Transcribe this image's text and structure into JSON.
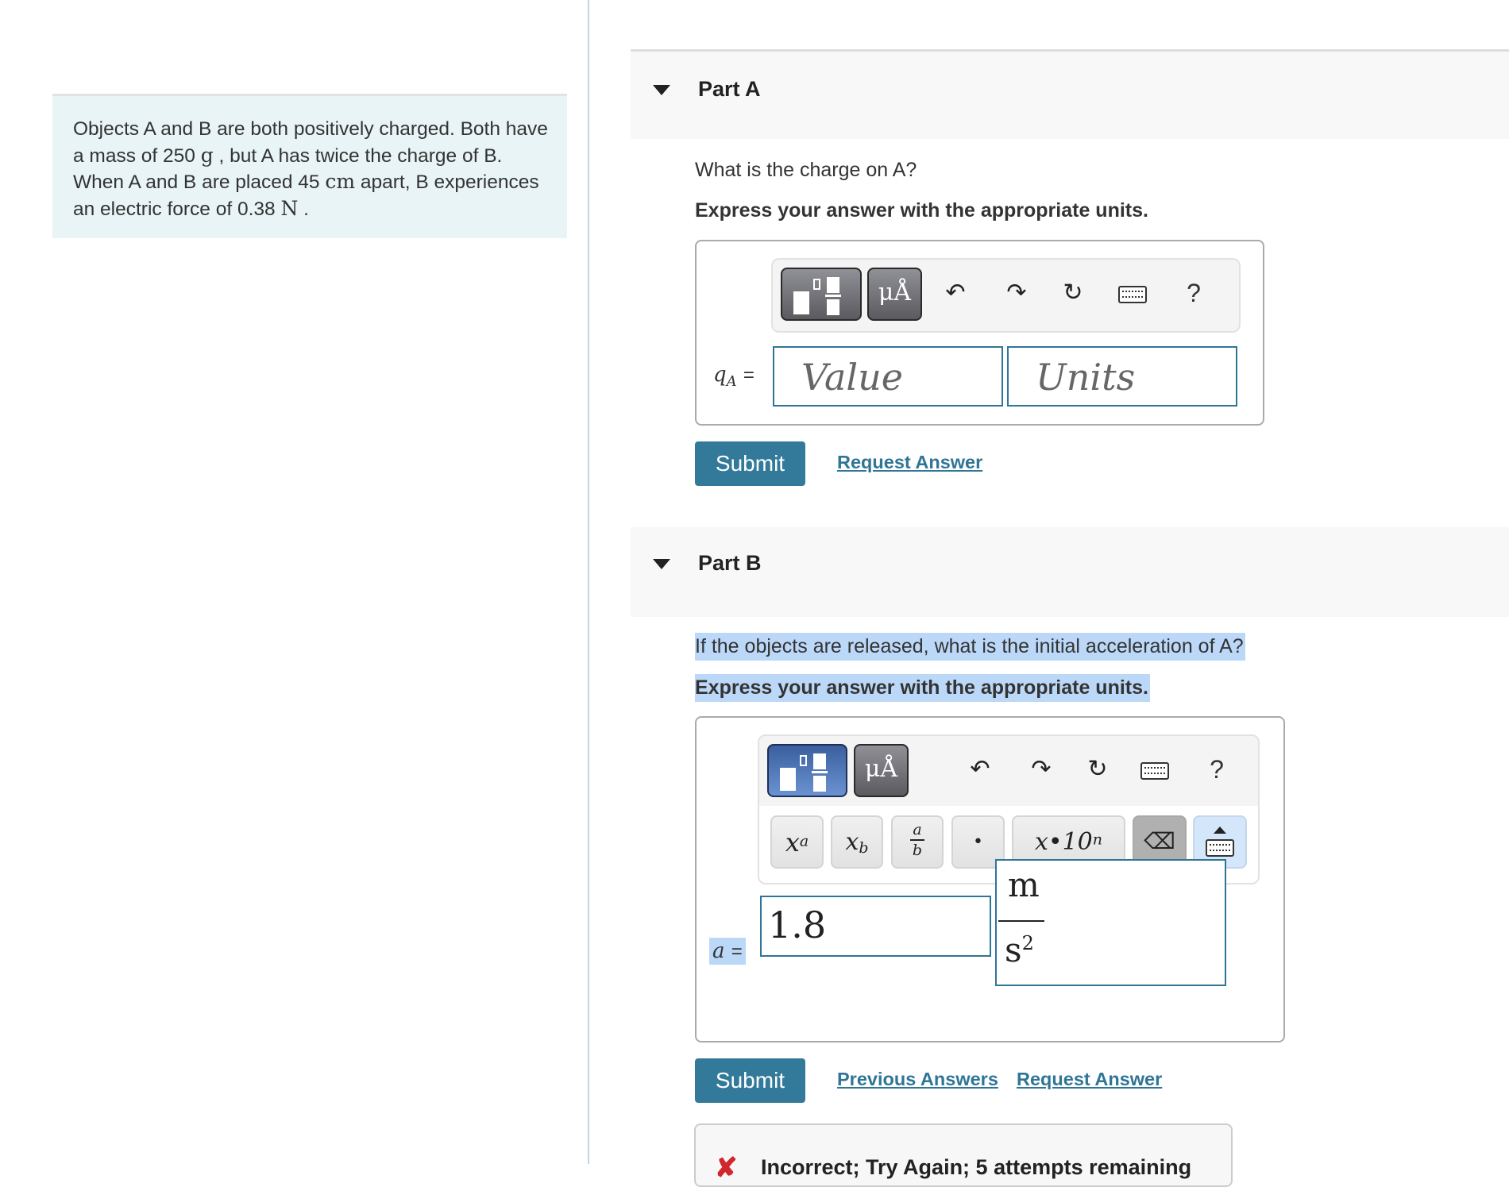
{
  "problem": {
    "text_parts": [
      "Objects A and B are both positively charged. Both have a mass of 250 ",
      "g",
      " , but A has twice the charge of B. When A and B are placed 45 ",
      "cm",
      " apart, B experiences an electric force of 0.38 ",
      "N",
      " ."
    ]
  },
  "toolbar": {
    "template_icon": "templates-icon",
    "units_label": "μÅ",
    "undo_icon": "↶",
    "redo_icon": "↷",
    "reset_icon": "↻",
    "help_label": "?"
  },
  "part_a": {
    "title": "Part A",
    "question": "What is the charge on A?",
    "instruction": "Express your answer with the appropriate units.",
    "label_var": "q",
    "label_sub": "A",
    "label_eq": "=",
    "value_placeholder": "Value",
    "units_placeholder": "Units",
    "submit_label": "Submit",
    "request_answer_label": "Request Answer"
  },
  "part_b": {
    "title": "Part B",
    "question": "If the objects are released, what is the initial acceleration of A?",
    "instruction": "Express your answer with the appropriate units.",
    "label_var": "a",
    "label_eq": "=",
    "value": "1.8",
    "units_numerator": "m",
    "units_denominator": "s",
    "units_denominator_exp": "2",
    "keys": {
      "superscript": {
        "base": "x",
        "sup": "a"
      },
      "subscript": {
        "base": "x",
        "sub": "b"
      },
      "fraction": {
        "num": "a",
        "den": "b"
      },
      "dot": "•",
      "sci": {
        "base": "x•10",
        "sup": "n"
      },
      "backspace": "⌫"
    },
    "submit_label": "Submit",
    "previous_answers_label": "Previous Answers",
    "request_answer_label": "Request Answer",
    "feedback": {
      "icon": "✘",
      "text": "Incorrect; Try Again; 5 attempts remaining",
      "color": "#d0282c"
    }
  },
  "colors": {
    "accent": "#337a9a",
    "link": "#2f7596",
    "selection": "#bcd8f8",
    "problem_bg": "#e8f4f6"
  }
}
